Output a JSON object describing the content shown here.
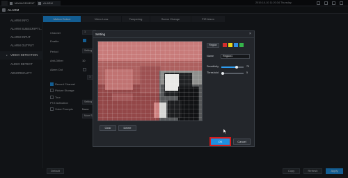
{
  "topbar": {
    "tabs": [
      {
        "label": "MANAGEMENT"
      },
      {
        "label": "ALARM"
      }
    ],
    "datetime": "2019-10-10 11:20:34 Thursday"
  },
  "breadcrumb": {
    "title": "ALARM"
  },
  "sidebar": {
    "items": [
      {
        "label": "ALARM INFO"
      },
      {
        "label": "ALARM SUBSCRIPTI..."
      },
      {
        "label": "ALARM INPUT"
      },
      {
        "label": "ALARM OUTPUT"
      },
      {
        "label": "VIDEO DETECTION"
      },
      {
        "label": "AUDIO DETECT"
      },
      {
        "label": "ABNORMALITY"
      }
    ]
  },
  "main_tabs": [
    {
      "label": "Motion Detect"
    },
    {
      "label": "Video Loss"
    },
    {
      "label": "Tampering"
    },
    {
      "label": "Scene Change"
    },
    {
      "label": "PIR Alarm"
    }
  ],
  "form": {
    "channel_label": "Channel",
    "channel_value": "1",
    "enable_label": "Enable",
    "period_label": "Period",
    "period_btn": "Setting",
    "anti_dither_label": "Anti-Dither",
    "anti_dither_value": "10",
    "alarm_out_label": "Alarm Out",
    "alarm_out_value": "1",
    "record_channel_label": "Record Channel",
    "picture_storage_label": "Picture Storage",
    "tour_label": "Tour",
    "ptz_label": "PTZ Activation",
    "ptz_btn": "Setting",
    "voice_prompts_label": "Voice Prompts",
    "voice_value": "None",
    "more_btn": "More S..."
  },
  "bottom_buttons": {
    "default": "Default",
    "copy": "Copy",
    "refresh": "Refresh",
    "apply": "Apply"
  },
  "dialog": {
    "title": "Setting",
    "close": "×",
    "region_label": "Region",
    "swatch_colors": [
      "#d42d2d",
      "#e8d21c",
      "#2e8de6",
      "#35b44a"
    ],
    "name_label": "Name",
    "name_value": "Region1",
    "sensitivity_label": "Sensitivity",
    "sensitivity_value": "70",
    "threshold_label": "Threshold",
    "threshold_value": "5",
    "clear_btn": "Clear",
    "delete_btn": "Delete",
    "ok_btn": "OK",
    "cancel_btn": "Cancel"
  },
  "colors": {
    "accent": "#1e8fe0",
    "ok_highlight": "#d71b1b",
    "motion_grid": "#c73b3b"
  }
}
